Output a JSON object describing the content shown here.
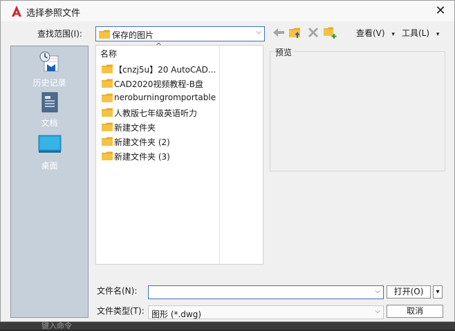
{
  "window": {
    "title": "选择参照文件",
    "close_symbol": "✕"
  },
  "look_in": {
    "label": "查找范围(I):",
    "value": "保存的图片"
  },
  "toolbar": {
    "icons": [
      "back-arrow-icon",
      "up-folder-icon",
      "delete-icon",
      "new-folder-icon"
    ],
    "view_label": "查看(V)",
    "tools_label": "工具(L)",
    "menu_arrow": "▾"
  },
  "places": [
    {
      "label": "历史记录",
      "icon": "history-icon"
    },
    {
      "label": "文档",
      "icon": "documents-icon"
    },
    {
      "label": "桌面",
      "icon": "desktop-icon"
    }
  ],
  "file_list": {
    "column_header": "名称",
    "sort_indicator": "^",
    "items": [
      "【cnzj5u】20 AutoCAD...",
      "CAD2020视频教程-B盘",
      "neroburningromportable",
      "人教版七年级英语听力",
      "新建文件夹",
      "新建文件夹 (2)",
      "新建文件夹 (3)"
    ]
  },
  "preview": {
    "label": "预览"
  },
  "file_name": {
    "label": "文件名(N):",
    "value": ""
  },
  "file_type": {
    "label": "文件类型(T):",
    "value": "图形 (*.dwg)"
  },
  "buttons": {
    "open": "打开(O)",
    "open_menu": "▾",
    "cancel": "取消"
  },
  "background": {
    "text": "键入命令"
  },
  "colors": {
    "folder": "#f5c342",
    "places_bg": "#c6d0da",
    "accent": "#3d6fbf"
  }
}
